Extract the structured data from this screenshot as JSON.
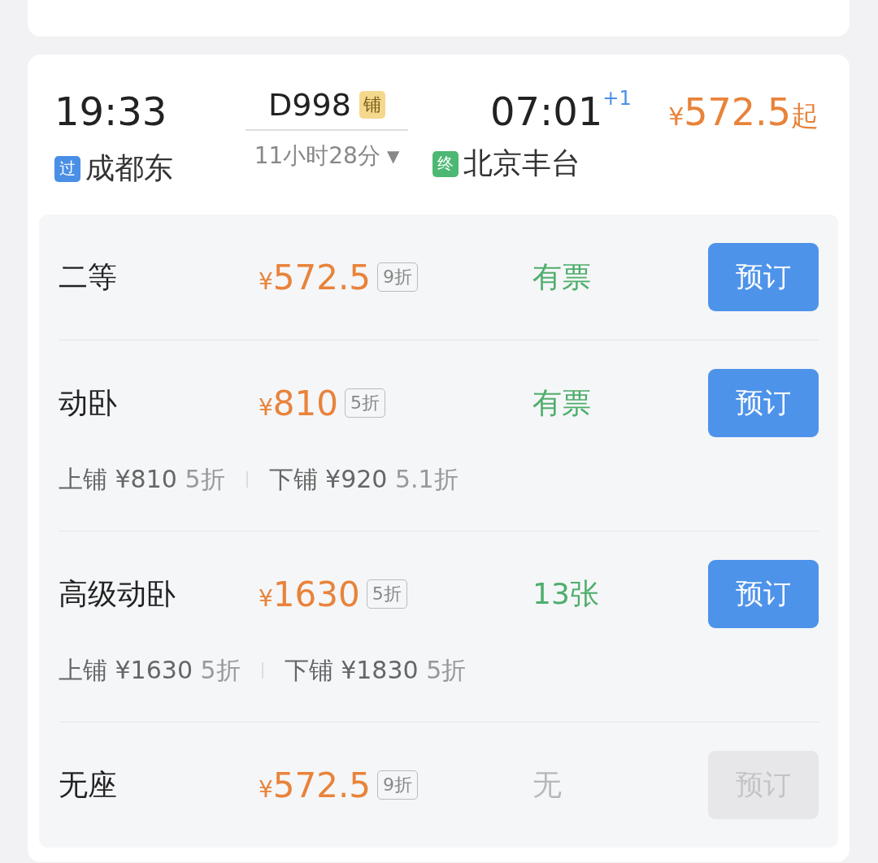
{
  "train": {
    "depart_time": "19:33",
    "depart_station": {
      "badge": "过",
      "name": "成都东",
      "kind": "pass"
    },
    "train_no": "D998",
    "train_tag": "铺",
    "duration": "11小时28分",
    "expand_icon": "▼",
    "arrive_time": "07:01",
    "day_offset": "+1",
    "arrive_station": {
      "badge": "终",
      "name": "北京丰台",
      "kind": "terminal"
    },
    "price_currency": "¥",
    "price_amount": "572.5",
    "price_suffix": "起"
  },
  "seats": [
    {
      "name": "二等",
      "currency": "¥",
      "amount": "572.5",
      "discount": "9折",
      "availability": "有票",
      "available": true,
      "button": {
        "label": "预订",
        "disabled": false
      }
    },
    {
      "name": "动卧",
      "currency": "¥",
      "amount": "810",
      "discount": "5折",
      "availability": "有票",
      "available": true,
      "button": {
        "label": "预订",
        "disabled": false
      },
      "berths": [
        {
          "label": "上铺",
          "price": "¥810",
          "discount": "5折"
        },
        {
          "label": "下铺",
          "price": "¥920",
          "discount": "5.1折"
        }
      ]
    },
    {
      "name": "高级动卧",
      "currency": "¥",
      "amount": "1630",
      "discount": "5折",
      "availability": "13张",
      "available": true,
      "button": {
        "label": "预订",
        "disabled": false
      },
      "berths": [
        {
          "label": "上铺",
          "price": "¥1630",
          "discount": "5折"
        },
        {
          "label": "下铺",
          "price": "¥1830",
          "discount": "5折"
        }
      ]
    },
    {
      "name": "无座",
      "currency": "¥",
      "amount": "572.5",
      "discount": "9折",
      "availability": "无",
      "available": false,
      "button": {
        "label": "预订",
        "disabled": true
      }
    }
  ]
}
